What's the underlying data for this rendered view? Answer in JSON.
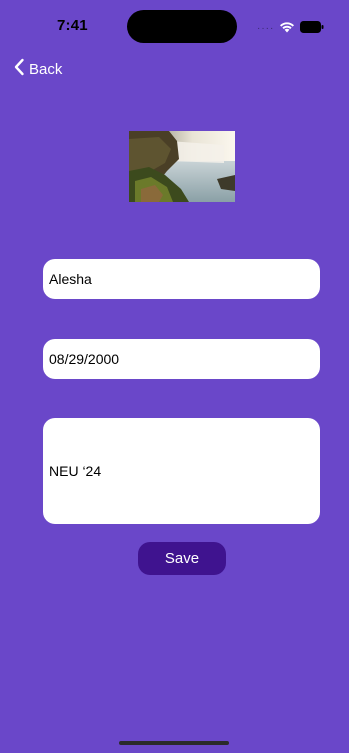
{
  "status_bar": {
    "time": "7:41",
    "signal_icon": "signal-dots-icon",
    "wifi_icon": "wifi-icon",
    "battery_icon": "battery-icon"
  },
  "nav": {
    "back_label": "Back",
    "back_icon": "chevron-left-icon"
  },
  "photo": {
    "subject": "waterfall landscape"
  },
  "form": {
    "name_value": "Alesha",
    "date_value": "08/29/2000",
    "notes_value": "NEU ‘24",
    "save_label": "Save"
  },
  "colors": {
    "background": "#6A47C9",
    "save_button": "#3F138F",
    "field": "#FFFFFF"
  }
}
